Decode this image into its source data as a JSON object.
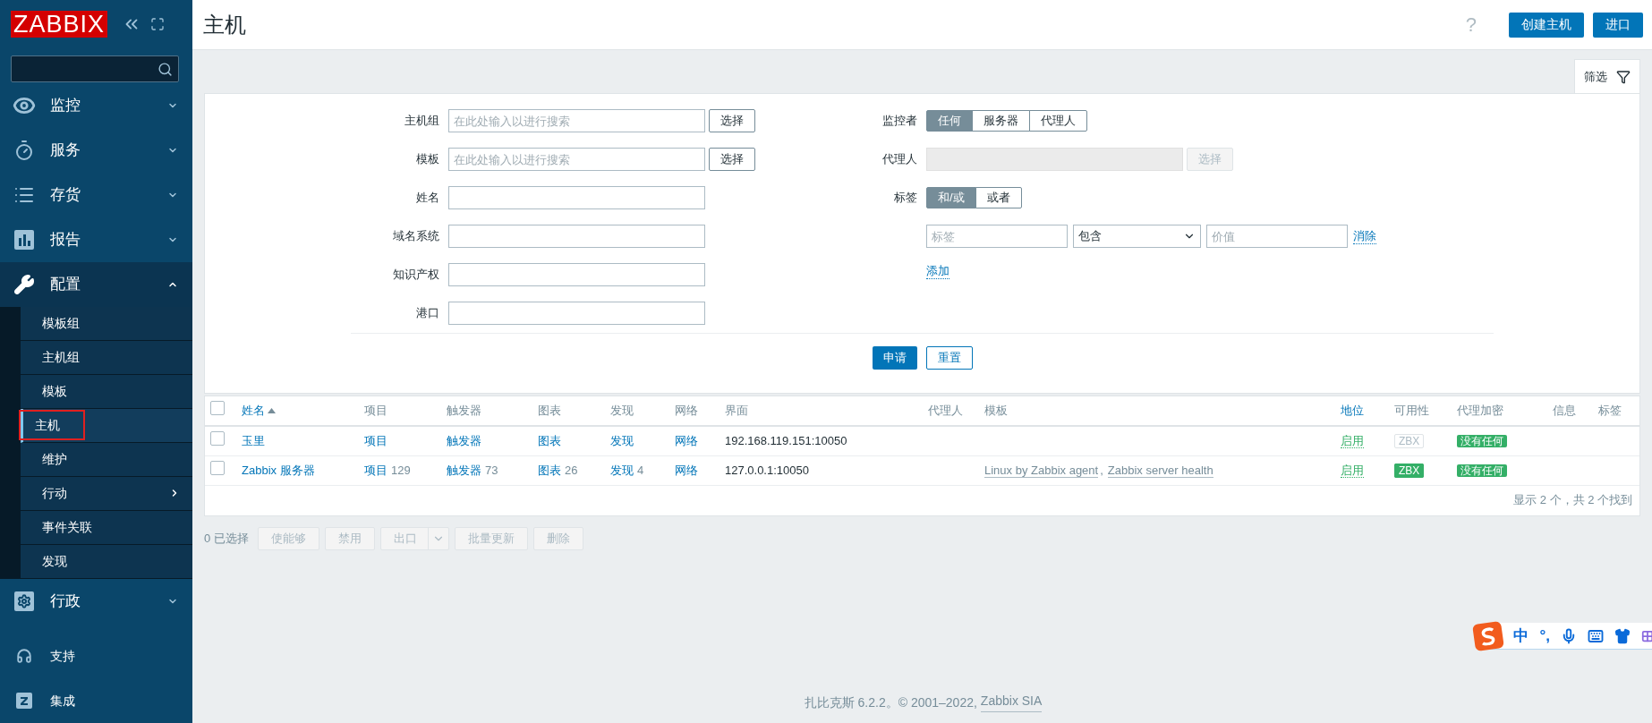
{
  "logo": "ZABBIX",
  "sidebar": {
    "menu": [
      {
        "label": "监控",
        "kind": "eye",
        "expanded": false
      },
      {
        "label": "服务",
        "kind": "timer",
        "expanded": false
      },
      {
        "label": "存货",
        "kind": "list",
        "expanded": false
      },
      {
        "label": "报告",
        "kind": "chart",
        "expanded": false
      },
      {
        "label": "配置",
        "kind": "wrench",
        "expanded": true,
        "children": [
          {
            "label": "模板组",
            "selected": false,
            "has_submenu": false
          },
          {
            "label": "主机组",
            "selected": false,
            "has_submenu": false
          },
          {
            "label": "模板",
            "selected": false,
            "has_submenu": false
          },
          {
            "label": "主机",
            "selected": true,
            "has_submenu": false
          },
          {
            "label": "维护",
            "selected": false,
            "has_submenu": false
          },
          {
            "label": "行动",
            "selected": false,
            "has_submenu": true
          },
          {
            "label": "事件关联",
            "selected": false,
            "has_submenu": false
          },
          {
            "label": "发现",
            "selected": false,
            "has_submenu": false
          }
        ]
      },
      {
        "label": "行政",
        "kind": "cog",
        "expanded": false
      }
    ],
    "bottom": [
      {
        "label": "支持",
        "kind": "headset"
      },
      {
        "label": "集成",
        "kind": "z"
      }
    ]
  },
  "header": {
    "title": "主机",
    "help": "?",
    "buttons": [
      "创建主机",
      "进口"
    ]
  },
  "filter": {
    "tab": "筛选",
    "fields": [
      {
        "label": "主机组",
        "placeholder": "在此处输入以进行搜索",
        "button": "选择"
      },
      {
        "label": "模板",
        "placeholder": "在此处输入以进行搜索",
        "button": "选择"
      },
      {
        "label": "姓名"
      },
      {
        "label": "域名系统"
      },
      {
        "label": "知识产权"
      },
      {
        "label": "港口"
      }
    ],
    "monitored_by": {
      "label": "监控者",
      "options": [
        {
          "label": "任何",
          "selected": true
        },
        {
          "label": "服务器",
          "selected": false
        },
        {
          "label": "代理人",
          "selected": false
        }
      ]
    },
    "proxy": {
      "label": "代理人",
      "button": "选择",
      "disabled": true
    },
    "tags": {
      "label": "标签",
      "options": [
        {
          "label": "和/或",
          "selected": true
        },
        {
          "label": "或者",
          "selected": false
        }
      ],
      "row": {
        "tag_placeholder": "标签",
        "operator": "包含",
        "value_placeholder": "价值",
        "remove": "消除"
      },
      "add": "添加"
    },
    "apply": "申请",
    "reset": "重置"
  },
  "table": {
    "header_checked": false,
    "columns": [
      {
        "label": "姓名",
        "link": true,
        "sorted": true
      },
      {
        "label": "项目",
        "link": false,
        "sorted": false
      },
      {
        "label": "触发器",
        "link": false,
        "sorted": false
      },
      {
        "label": "图表",
        "link": false,
        "sorted": false
      },
      {
        "label": "发现",
        "link": false,
        "sorted": false
      },
      {
        "label": "网络",
        "link": false,
        "sorted": false
      },
      {
        "label": "界面",
        "link": false,
        "sorted": false
      },
      {
        "label": "代理人",
        "link": false,
        "sorted": false
      },
      {
        "label": "模板",
        "link": false,
        "sorted": false
      },
      {
        "label": "地位",
        "link": true,
        "sorted": false
      },
      {
        "label": "可用性",
        "link": false,
        "sorted": false
      },
      {
        "label": "代理加密",
        "link": false,
        "sorted": false
      },
      {
        "label": "信息",
        "link": false,
        "sorted": false
      },
      {
        "label": "标签",
        "link": false,
        "sorted": false
      }
    ],
    "template_separator": ",",
    "rows": [
      {
        "checked": false,
        "name": "玉里",
        "items": {
          "label": "项目"
        },
        "triggers": {
          "label": "触发器"
        },
        "graphs": {
          "label": "图表"
        },
        "discovery": {
          "label": "发现"
        },
        "web": "网络",
        "interface": "192.168.119.151:10050",
        "templates": [],
        "status": "启用",
        "availability": {
          "label": "ZBX",
          "active": false
        },
        "encryption": "没有任何"
      },
      {
        "checked": false,
        "name": "Zabbix 服务器",
        "items": {
          "label": "项目",
          "count": "129"
        },
        "triggers": {
          "label": "触发器",
          "count": "73"
        },
        "graphs": {
          "label": "图表",
          "count": "26"
        },
        "discovery": {
          "label": "发现",
          "count": "4"
        },
        "web": "网络",
        "interface": "127.0.0.1:10050",
        "templates": [
          "Linux by Zabbix agent",
          "Zabbix server health"
        ],
        "status": "启用",
        "availability": {
          "label": "ZBX",
          "active": true
        },
        "encryption": "没有任何"
      }
    ],
    "summary": "显示 2 个，共 2 个找到"
  },
  "actions": {
    "selected": "0 已选择",
    "buttons": [
      {
        "label": "使能够",
        "disabled": true,
        "dropdown": false
      },
      {
        "label": "禁用",
        "disabled": true,
        "dropdown": false
      },
      {
        "label": "出口",
        "disabled": true,
        "dropdown": true
      },
      {
        "label": "批量更新",
        "disabled": true,
        "dropdown": false
      },
      {
        "label": "删除",
        "disabled": true,
        "dropdown": false
      }
    ]
  },
  "footer": {
    "text": "扎比克斯 6.2.2。© 2001–2022,",
    "link": "Zabbix SIA"
  },
  "ime": {
    "mode": "中",
    "punctuation": "°,"
  }
}
